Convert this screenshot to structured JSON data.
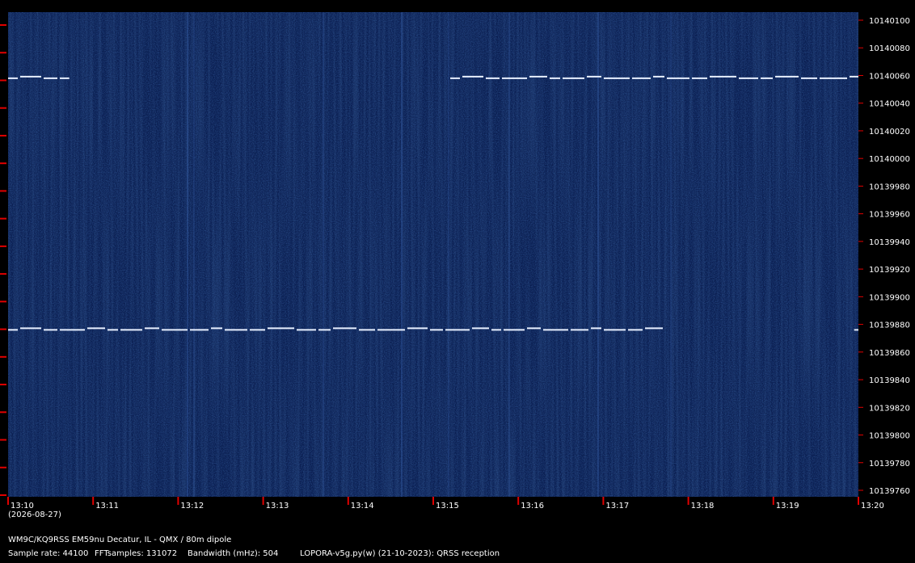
{
  "chart_data": {
    "type": "heatmap",
    "title": "",
    "xlabel": "",
    "ylabel": "",
    "x_ticks": [
      "13:10",
      "13:11",
      "13:12",
      "13:13",
      "13:14",
      "13:15",
      "13:16",
      "13:17",
      "13:18",
      "13:19",
      "13:20"
    ],
    "y_ticks": [
      10140100,
      10140080,
      10140060,
      10140040,
      10140020,
      10140000,
      10139980,
      10139960,
      10139940,
      10139920,
      10139900,
      10139880,
      10139860,
      10139840,
      10139820,
      10139800,
      10139780,
      10139760
    ],
    "xlim_minutes": [
      0,
      10
    ],
    "ylim_hz": [
      10139760,
      10140100
    ],
    "background_color": "#0b1f52",
    "tick_color": "#e00000",
    "trace_color": "#e8f0ff",
    "traces": [
      {
        "freq_hz": 10139876,
        "start_min": 0.0,
        "end_min": 7.7
      },
      {
        "freq_hz": 10139876,
        "start_min": 9.95,
        "end_min": 10.0
      },
      {
        "freq_hz": 10140058,
        "start_min": 0.0,
        "end_min": 0.72
      },
      {
        "freq_hz": 10140058,
        "start_min": 5.2,
        "end_min": 10.0
      }
    ]
  },
  "date_label": "(2026-08-27)",
  "footer": {
    "station": "WM9C/KQ9RSS EM59nu Decatur, IL - QMX / 80m dipole",
    "sample_rate": "Sample rate: 44100",
    "fft_samples": "FFTsamples: 131072",
    "bandwidth": "Bandwidth (mHz): 504",
    "software": "LOPORA-v5g.py(w) (21-10-2023): QRSS reception"
  }
}
